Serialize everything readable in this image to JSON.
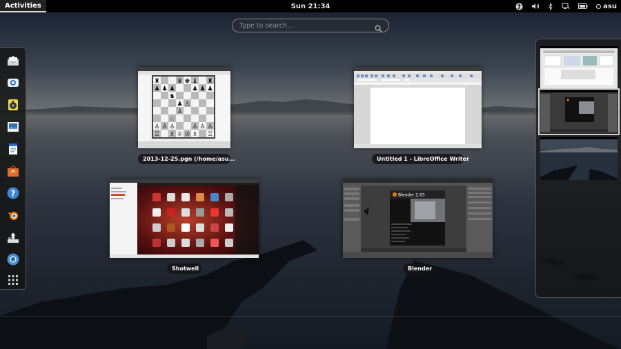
{
  "topbar": {
    "activities_label": "Activities",
    "clock": "Sun 21:34",
    "user": "asu",
    "indicators": [
      "accessibility-icon",
      "volume-icon",
      "bluetooth-icon",
      "network-icon",
      "battery-icon"
    ]
  },
  "search": {
    "placeholder": "Type to search..."
  },
  "dash": {
    "items": [
      {
        "name": "mail-app",
        "icon": "envelope-icon"
      },
      {
        "name": "chat-app",
        "icon": "chat-icon"
      },
      {
        "name": "music-app",
        "icon": "speaker-icon"
      },
      {
        "name": "photos-app",
        "icon": "photo-viewer-icon"
      },
      {
        "name": "writer-app",
        "icon": "document-icon"
      },
      {
        "name": "software-app",
        "icon": "shopping-bag-icon"
      },
      {
        "name": "help-app",
        "icon": "help-icon"
      },
      {
        "name": "blender-app",
        "icon": "blender-icon"
      },
      {
        "name": "chess-app",
        "icon": "chess-icon"
      },
      {
        "name": "chromium-app",
        "icon": "chromium-icon"
      },
      {
        "name": "show-applications",
        "icon": "grid-icon"
      }
    ]
  },
  "windows": [
    {
      "id": "chess",
      "label": "2013-12-25.pgn (/home/asu..."
    },
    {
      "id": "writer",
      "label": "Untitled 1 - LibreOffice Writer"
    },
    {
      "id": "shotwell",
      "label": "Shotwell"
    },
    {
      "id": "blender",
      "label": "Blender",
      "splash_title": "Blender 2.63"
    }
  ],
  "workspaces": {
    "count": 3,
    "active_index": 1
  },
  "colors": {
    "topbar_bg": "#000000",
    "panel_bg": "#141414",
    "active_outline": "#cfcfcf",
    "ubuntu_orange": "#c4401c"
  }
}
